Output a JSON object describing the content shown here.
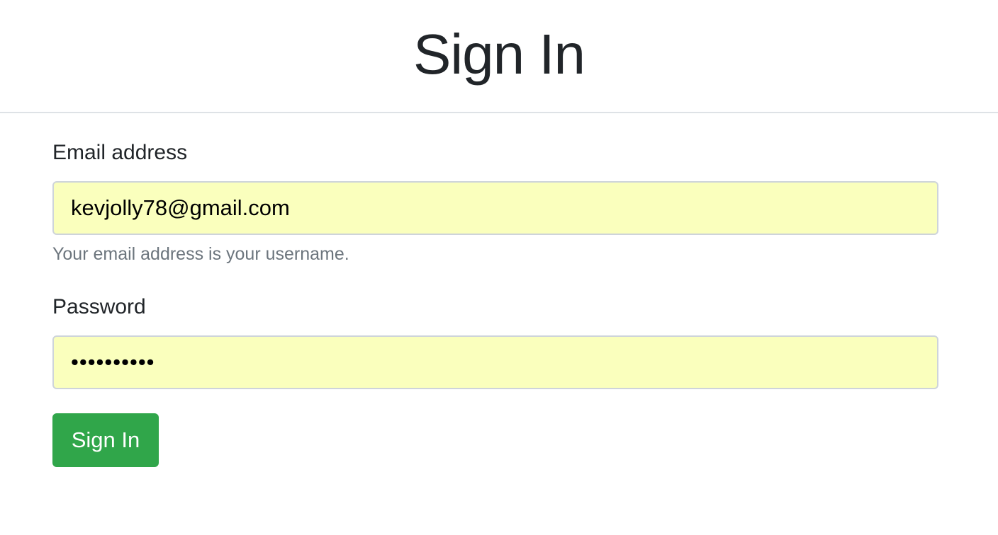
{
  "header": {
    "title": "Sign In"
  },
  "form": {
    "email": {
      "label": "Email address",
      "value": "kevjolly78@gmail.com",
      "help": "Your email address is your username."
    },
    "password": {
      "label": "Password",
      "value": "••••••••••"
    },
    "submit_label": "Sign In"
  },
  "colors": {
    "autofill_background": "#faffbd",
    "primary_button": "#30a64a",
    "help_text": "#6c757d",
    "text": "#212529"
  }
}
